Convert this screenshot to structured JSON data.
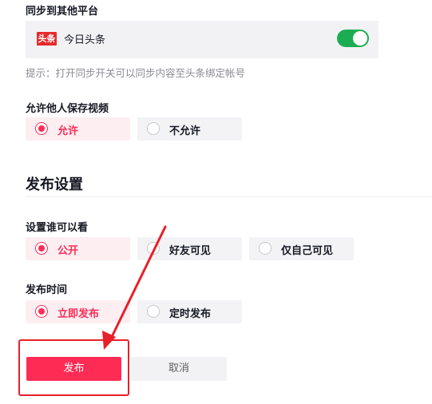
{
  "sync": {
    "label": "同步到其他平台",
    "platform_logo_text": "头条",
    "platform_name": "今日头条",
    "toggle_on": true,
    "hint": "提示：打开同步开关可以同步内容至头条绑定帐号"
  },
  "save_video": {
    "label": "允许他人保存视频",
    "options": [
      "允许",
      "不允许"
    ],
    "selected": "允许"
  },
  "publish_settings": {
    "title": "发布设置",
    "visibility": {
      "label": "设置谁可以看",
      "options": [
        "公开",
        "好友可见",
        "仅自己可见"
      ],
      "selected": "公开"
    },
    "publish_time": {
      "label": "发布时间",
      "options": [
        "立即发布",
        "定时发布"
      ],
      "selected": "立即发布"
    }
  },
  "actions": {
    "publish_label": "发布",
    "cancel_label": "取消"
  },
  "colors": {
    "accent": "#fe2c55",
    "toggle_on": "#1cad52",
    "annotation": "#e8202a"
  }
}
